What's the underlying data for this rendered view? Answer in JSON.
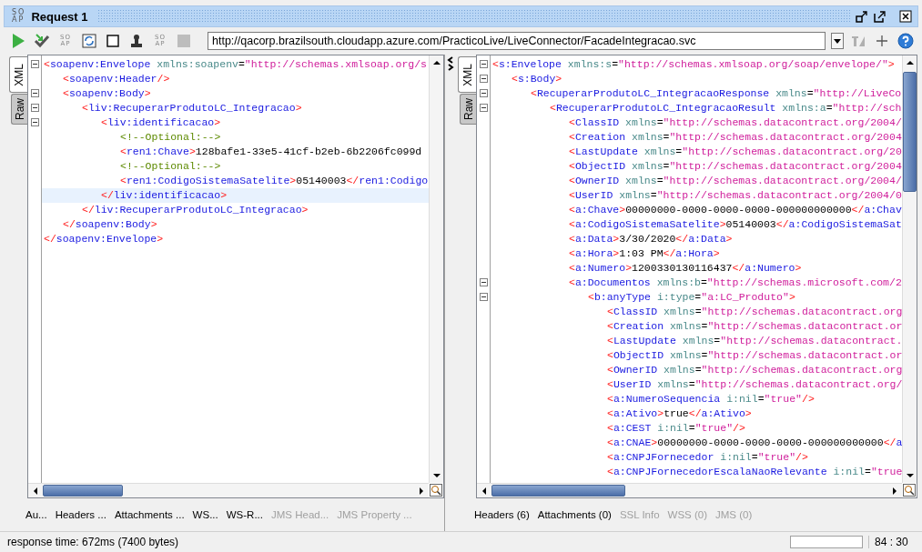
{
  "window": {
    "logo": [
      "SO",
      "AP"
    ],
    "title": "Request 1"
  },
  "toolbar": [
    {
      "kind": "run"
    },
    {
      "kind": "check"
    },
    {
      "kind": "soap",
      "glyph": [
        "SO",
        "AP"
      ]
    },
    {
      "kind": "refresh"
    },
    {
      "kind": "square"
    },
    {
      "kind": "stamp"
    },
    {
      "kind": "soap",
      "glyph": [
        "SO",
        "AP"
      ]
    },
    {
      "kind": "stop"
    }
  ],
  "url": {
    "value": "http://qacorp.brazilsouth.cloudapp.azure.com/PracticoLive/LiveConnector/FacadeIntegracao.svc"
  },
  "url_tools": [
    {
      "kind": "dropdown"
    },
    {
      "kind": "endpoint"
    },
    {
      "kind": "add"
    },
    {
      "kind": "help"
    }
  ],
  "left_pane": {
    "view_tabs": [
      {
        "label": "XML",
        "selected": true
      },
      {
        "label": "Raw",
        "selected": false
      }
    ],
    "lines": [
      {
        "tokens": [
          {
            "kind": "bracket",
            "text": "<"
          },
          {
            "kind": "tag",
            "text": "soapenv:Envelope"
          },
          {
            "kind": "attr",
            "text": " xmlns:soapenv"
          },
          {
            "kind": "equals",
            "text": "="
          },
          {
            "kind": "value",
            "text": "\"http://schemas.xmlsoap.org/s"
          }
        ],
        "expanded": true,
        "children": [
          {
            "tokens": [
              {
                "kind": "bracket",
                "text": "<"
              },
              {
                "kind": "tag",
                "text": "soapenv:Header"
              },
              {
                "kind": "bracket",
                "text": "/>"
              }
            ]
          },
          {
            "tokens": [
              {
                "kind": "bracket",
                "text": "<"
              },
              {
                "kind": "tag",
                "text": "soapenv:Body"
              },
              {
                "kind": "bracket",
                "text": ">"
              }
            ],
            "expanded": true,
            "children": [
              {
                "tokens": [
                  {
                    "kind": "bracket",
                    "text": "<"
                  },
                  {
                    "kind": "tag",
                    "text": "liv:RecuperarProdutoLC_Integracao"
                  },
                  {
                    "kind": "bracket",
                    "text": ">"
                  }
                ],
                "expanded": true,
                "children": [
                  {
                    "tokens": [
                      {
                        "kind": "bracket",
                        "text": "<"
                      },
                      {
                        "kind": "tag",
                        "text": "liv:identificacao"
                      },
                      {
                        "kind": "bracket",
                        "text": ">"
                      }
                    ],
                    "expanded": true,
                    "children": [
                      {
                        "tokens": [
                          {
                            "kind": "comment",
                            "text": "<!--Optional:-->"
                          }
                        ]
                      },
                      {
                        "tokens": [
                          {
                            "kind": "bracket",
                            "text": "<"
                          },
                          {
                            "kind": "tag",
                            "text": "ren1:Chave"
                          },
                          {
                            "kind": "bracket",
                            "text": ">"
                          },
                          {
                            "kind": "text",
                            "text": "128bafe1-33e5-41cf-b2eb-6b2206fc099d"
                          }
                        ]
                      },
                      {
                        "tokens": [
                          {
                            "kind": "comment",
                            "text": "<!--Optional:-->"
                          }
                        ]
                      },
                      {
                        "tokens": [
                          {
                            "kind": "bracket",
                            "text": "<"
                          },
                          {
                            "kind": "tag",
                            "text": "ren1:CodigoSistemaSatelite"
                          },
                          {
                            "kind": "bracket",
                            "text": ">"
                          },
                          {
                            "kind": "text",
                            "text": "05140003"
                          },
                          {
                            "kind": "bracket",
                            "text": "</"
                          },
                          {
                            "kind": "tag",
                            "text": "ren1:Codigo"
                          }
                        ]
                      }
                    ]
                  },
                  {
                    "tokens": [
                      {
                        "kind": "bracket",
                        "text": "</"
                      },
                      {
                        "kind": "tag",
                        "text": "liv:identificacao"
                      },
                      {
                        "kind": "bracket",
                        "text": ">"
                      }
                    ],
                    "current": true
                  }
                ]
              },
              {
                "tokens": [
                  {
                    "kind": "bracket",
                    "text": "</"
                  },
                  {
                    "kind": "tag",
                    "text": "liv:RecuperarProdutoLC_Integracao"
                  },
                  {
                    "kind": "bracket",
                    "text": ">"
                  }
                ]
              }
            ]
          },
          {
            "tokens": [
              {
                "kind": "bracket",
                "text": "</"
              },
              {
                "kind": "tag",
                "text": "soapenv:Body"
              },
              {
                "kind": "bracket",
                "text": ">"
              }
            ]
          }
        ]
      },
      {
        "tokens": [
          {
            "kind": "bracket",
            "text": "</"
          },
          {
            "kind": "tag",
            "text": "soapenv:Envelope"
          },
          {
            "kind": "bracket",
            "text": ">"
          }
        ]
      }
    ],
    "bottom_tabs": [
      {
        "label": "Au...",
        "disabled": false
      },
      {
        "label": "Headers ...",
        "disabled": false
      },
      {
        "label": "Attachments ...",
        "disabled": false
      },
      {
        "label": "WS...",
        "disabled": false
      },
      {
        "label": "WS-R...",
        "disabled": false
      },
      {
        "label": "JMS Head...",
        "disabled": true
      },
      {
        "label": "JMS Property ...",
        "disabled": true
      }
    ]
  },
  "right_pane": {
    "view_tabs": [
      {
        "label": "XML",
        "selected": true
      },
      {
        "label": "Raw",
        "selected": false
      }
    ],
    "lines": [
      {
        "tokens": [
          {
            "kind": "bracket",
            "text": "<"
          },
          {
            "kind": "tag",
            "text": "s:Envelope"
          },
          {
            "kind": "attr",
            "text": " xmlns:s"
          },
          {
            "kind": "equals",
            "text": "="
          },
          {
            "kind": "value",
            "text": "\"http://schemas.xmlsoap.org/soap/envelope/\""
          },
          {
            "kind": "bracket",
            "text": ">"
          }
        ],
        "expanded": true,
        "children": [
          {
            "tokens": [
              {
                "kind": "bracket",
                "text": "<"
              },
              {
                "kind": "tag",
                "text": "s:Body"
              },
              {
                "kind": "bracket",
                "text": ">"
              }
            ],
            "expanded": true,
            "children": [
              {
                "tokens": [
                  {
                    "kind": "bracket",
                    "text": "<"
                  },
                  {
                    "kind": "tag",
                    "text": "RecuperarProdutoLC_IntegracaoResponse"
                  },
                  {
                    "kind": "attr",
                    "text": " xmlns"
                  },
                  {
                    "kind": "equals",
                    "text": "="
                  },
                  {
                    "kind": "value",
                    "text": "\"http://LiveCo"
                  }
                ],
                "expanded": true,
                "children": [
                  {
                    "tokens": [
                      {
                        "kind": "bracket",
                        "text": "<"
                      },
                      {
                        "kind": "tag",
                        "text": "RecuperarProdutoLC_IntegracaoResult"
                      },
                      {
                        "kind": "attr",
                        "text": " xmlns:a"
                      },
                      {
                        "kind": "equals",
                        "text": "="
                      },
                      {
                        "kind": "value",
                        "text": "\"http://sch"
                      }
                    ],
                    "expanded": true,
                    "children": [
                      {
                        "tokens": [
                          {
                            "kind": "bracket",
                            "text": "<"
                          },
                          {
                            "kind": "tag",
                            "text": "ClassID"
                          },
                          {
                            "kind": "attr",
                            "text": " xmlns"
                          },
                          {
                            "kind": "equals",
                            "text": "="
                          },
                          {
                            "kind": "value",
                            "text": "\"http://schemas.datacontract.org/2004/"
                          }
                        ]
                      },
                      {
                        "tokens": [
                          {
                            "kind": "bracket",
                            "text": "<"
                          },
                          {
                            "kind": "tag",
                            "text": "Creation"
                          },
                          {
                            "kind": "attr",
                            "text": " xmlns"
                          },
                          {
                            "kind": "equals",
                            "text": "="
                          },
                          {
                            "kind": "value",
                            "text": "\"http://schemas.datacontract.org/2004"
                          }
                        ]
                      },
                      {
                        "tokens": [
                          {
                            "kind": "bracket",
                            "text": "<"
                          },
                          {
                            "kind": "tag",
                            "text": "LastUpdate"
                          },
                          {
                            "kind": "attr",
                            "text": " xmlns"
                          },
                          {
                            "kind": "equals",
                            "text": "="
                          },
                          {
                            "kind": "value",
                            "text": "\"http://schemas.datacontract.org/20"
                          }
                        ]
                      },
                      {
                        "tokens": [
                          {
                            "kind": "bracket",
                            "text": "<"
                          },
                          {
                            "kind": "tag",
                            "text": "ObjectID"
                          },
                          {
                            "kind": "attr",
                            "text": " xmlns"
                          },
                          {
                            "kind": "equals",
                            "text": "="
                          },
                          {
                            "kind": "value",
                            "text": "\"http://schemas.datacontract.org/2004"
                          }
                        ]
                      },
                      {
                        "tokens": [
                          {
                            "kind": "bracket",
                            "text": "<"
                          },
                          {
                            "kind": "tag",
                            "text": "OwnerID"
                          },
                          {
                            "kind": "attr",
                            "text": " xmlns"
                          },
                          {
                            "kind": "equals",
                            "text": "="
                          },
                          {
                            "kind": "value",
                            "text": "\"http://schemas.datacontract.org/2004/"
                          }
                        ]
                      },
                      {
                        "tokens": [
                          {
                            "kind": "bracket",
                            "text": "<"
                          },
                          {
                            "kind": "tag",
                            "text": "UserID"
                          },
                          {
                            "kind": "attr",
                            "text": " xmlns"
                          },
                          {
                            "kind": "equals",
                            "text": "="
                          },
                          {
                            "kind": "value",
                            "text": "\"http://schemas.datacontract.org/2004/0"
                          }
                        ]
                      },
                      {
                        "tokens": [
                          {
                            "kind": "bracket",
                            "text": "<"
                          },
                          {
                            "kind": "tag",
                            "text": "a:Chave"
                          },
                          {
                            "kind": "bracket",
                            "text": ">"
                          },
                          {
                            "kind": "text",
                            "text": "00000000-0000-0000-0000-000000000000"
                          },
                          {
                            "kind": "bracket",
                            "text": "</"
                          },
                          {
                            "kind": "tag",
                            "text": "a:Chav"
                          }
                        ]
                      },
                      {
                        "tokens": [
                          {
                            "kind": "bracket",
                            "text": "<"
                          },
                          {
                            "kind": "tag",
                            "text": "a:CodigoSistemaSatelite"
                          },
                          {
                            "kind": "bracket",
                            "text": ">"
                          },
                          {
                            "kind": "text",
                            "text": "05140003"
                          },
                          {
                            "kind": "bracket",
                            "text": "</"
                          },
                          {
                            "kind": "tag",
                            "text": "a:CodigoSistemaSat"
                          }
                        ]
                      },
                      {
                        "tokens": [
                          {
                            "kind": "bracket",
                            "text": "<"
                          },
                          {
                            "kind": "tag",
                            "text": "a:Data"
                          },
                          {
                            "kind": "bracket",
                            "text": ">"
                          },
                          {
                            "kind": "text",
                            "text": "3/30/2020"
                          },
                          {
                            "kind": "bracket",
                            "text": "</"
                          },
                          {
                            "kind": "tag",
                            "text": "a:Data"
                          },
                          {
                            "kind": "bracket",
                            "text": ">"
                          }
                        ]
                      },
                      {
                        "tokens": [
                          {
                            "kind": "bracket",
                            "text": "<"
                          },
                          {
                            "kind": "tag",
                            "text": "a:Hora"
                          },
                          {
                            "kind": "bracket",
                            "text": ">"
                          },
                          {
                            "kind": "text",
                            "text": "1:03 PM"
                          },
                          {
                            "kind": "bracket",
                            "text": "</"
                          },
                          {
                            "kind": "tag",
                            "text": "a:Hora"
                          },
                          {
                            "kind": "bracket",
                            "text": ">"
                          }
                        ]
                      },
                      {
                        "tokens": [
                          {
                            "kind": "bracket",
                            "text": "<"
                          },
                          {
                            "kind": "tag",
                            "text": "a:Numero"
                          },
                          {
                            "kind": "bracket",
                            "text": ">"
                          },
                          {
                            "kind": "text",
                            "text": "1200330130116437"
                          },
                          {
                            "kind": "bracket",
                            "text": "</"
                          },
                          {
                            "kind": "tag",
                            "text": "a:Numero"
                          },
                          {
                            "kind": "bracket",
                            "text": ">"
                          }
                        ]
                      },
                      {
                        "tokens": [
                          {
                            "kind": "bracket",
                            "text": "<"
                          },
                          {
                            "kind": "tag",
                            "text": "a:Documentos"
                          },
                          {
                            "kind": "attr",
                            "text": " xmlns:b"
                          },
                          {
                            "kind": "equals",
                            "text": "="
                          },
                          {
                            "kind": "value",
                            "text": "\"http://schemas.microsoft.com/2"
                          }
                        ],
                        "expanded": true,
                        "children": [
                          {
                            "tokens": [
                              {
                                "kind": "bracket",
                                "text": "<"
                              },
                              {
                                "kind": "tag",
                                "text": "b:anyType"
                              },
                              {
                                "kind": "attr",
                                "text": " i:type"
                              },
                              {
                                "kind": "equals",
                                "text": "="
                              },
                              {
                                "kind": "value",
                                "text": "\"a:LC_Produto\""
                              },
                              {
                                "kind": "bracket",
                                "text": ">"
                              }
                            ],
                            "expanded": true,
                            "children": [
                              {
                                "tokens": [
                                  {
                                    "kind": "bracket",
                                    "text": "<"
                                  },
                                  {
                                    "kind": "tag",
                                    "text": "ClassID"
                                  },
                                  {
                                    "kind": "attr",
                                    "text": " xmlns"
                                  },
                                  {
                                    "kind": "equals",
                                    "text": "="
                                  },
                                  {
                                    "kind": "value",
                                    "text": "\"http://schemas.datacontract.org"
                                  }
                                ]
                              },
                              {
                                "tokens": [
                                  {
                                    "kind": "bracket",
                                    "text": "<"
                                  },
                                  {
                                    "kind": "tag",
                                    "text": "Creation"
                                  },
                                  {
                                    "kind": "attr",
                                    "text": " xmlns"
                                  },
                                  {
                                    "kind": "equals",
                                    "text": "="
                                  },
                                  {
                                    "kind": "value",
                                    "text": "\"http://schemas.datacontract.or"
                                  }
                                ]
                              },
                              {
                                "tokens": [
                                  {
                                    "kind": "bracket",
                                    "text": "<"
                                  },
                                  {
                                    "kind": "tag",
                                    "text": "LastUpdate"
                                  },
                                  {
                                    "kind": "attr",
                                    "text": " xmlns"
                                  },
                                  {
                                    "kind": "equals",
                                    "text": "="
                                  },
                                  {
                                    "kind": "value",
                                    "text": "\"http://schemas.datacontract."
                                  }
                                ]
                              },
                              {
                                "tokens": [
                                  {
                                    "kind": "bracket",
                                    "text": "<"
                                  },
                                  {
                                    "kind": "tag",
                                    "text": "ObjectID"
                                  },
                                  {
                                    "kind": "attr",
                                    "text": " xmlns"
                                  },
                                  {
                                    "kind": "equals",
                                    "text": "="
                                  },
                                  {
                                    "kind": "value",
                                    "text": "\"http://schemas.datacontract.or"
                                  }
                                ]
                              },
                              {
                                "tokens": [
                                  {
                                    "kind": "bracket",
                                    "text": "<"
                                  },
                                  {
                                    "kind": "tag",
                                    "text": "OwnerID"
                                  },
                                  {
                                    "kind": "attr",
                                    "text": " xmlns"
                                  },
                                  {
                                    "kind": "equals",
                                    "text": "="
                                  },
                                  {
                                    "kind": "value",
                                    "text": "\"http://schemas.datacontract.org"
                                  }
                                ]
                              },
                              {
                                "tokens": [
                                  {
                                    "kind": "bracket",
                                    "text": "<"
                                  },
                                  {
                                    "kind": "tag",
                                    "text": "UserID"
                                  },
                                  {
                                    "kind": "attr",
                                    "text": " xmlns"
                                  },
                                  {
                                    "kind": "equals",
                                    "text": "="
                                  },
                                  {
                                    "kind": "value",
                                    "text": "\"http://schemas.datacontract.org/"
                                  }
                                ]
                              },
                              {
                                "tokens": [
                                  {
                                    "kind": "bracket",
                                    "text": "<"
                                  },
                                  {
                                    "kind": "tag",
                                    "text": "a:NumeroSequencia"
                                  },
                                  {
                                    "kind": "attr",
                                    "text": " i:nil"
                                  },
                                  {
                                    "kind": "equals",
                                    "text": "="
                                  },
                                  {
                                    "kind": "value",
                                    "text": "\"true\""
                                  },
                                  {
                                    "kind": "bracket",
                                    "text": "/>"
                                  }
                                ]
                              },
                              {
                                "tokens": [
                                  {
                                    "kind": "bracket",
                                    "text": "<"
                                  },
                                  {
                                    "kind": "tag",
                                    "text": "a:Ativo"
                                  },
                                  {
                                    "kind": "bracket",
                                    "text": ">"
                                  },
                                  {
                                    "kind": "text",
                                    "text": "true"
                                  },
                                  {
                                    "kind": "bracket",
                                    "text": "</"
                                  },
                                  {
                                    "kind": "tag",
                                    "text": "a:Ativo"
                                  },
                                  {
                                    "kind": "bracket",
                                    "text": ">"
                                  }
                                ]
                              },
                              {
                                "tokens": [
                                  {
                                    "kind": "bracket",
                                    "text": "<"
                                  },
                                  {
                                    "kind": "tag",
                                    "text": "a:CEST"
                                  },
                                  {
                                    "kind": "attr",
                                    "text": " i:nil"
                                  },
                                  {
                                    "kind": "equals",
                                    "text": "="
                                  },
                                  {
                                    "kind": "value",
                                    "text": "\"true\""
                                  },
                                  {
                                    "kind": "bracket",
                                    "text": "/>"
                                  }
                                ]
                              },
                              {
                                "tokens": [
                                  {
                                    "kind": "bracket",
                                    "text": "<"
                                  },
                                  {
                                    "kind": "tag",
                                    "text": "a:CNAE"
                                  },
                                  {
                                    "kind": "bracket",
                                    "text": ">"
                                  },
                                  {
                                    "kind": "text",
                                    "text": "00000000-0000-0000-0000-000000000000"
                                  },
                                  {
                                    "kind": "bracket",
                                    "text": "</"
                                  },
                                  {
                                    "kind": "tag",
                                    "text": "a"
                                  }
                                ]
                              },
                              {
                                "tokens": [
                                  {
                                    "kind": "bracket",
                                    "text": "<"
                                  },
                                  {
                                    "kind": "tag",
                                    "text": "a:CNPJFornecedor"
                                  },
                                  {
                                    "kind": "attr",
                                    "text": " i:nil"
                                  },
                                  {
                                    "kind": "equals",
                                    "text": "="
                                  },
                                  {
                                    "kind": "value",
                                    "text": "\"true\""
                                  },
                                  {
                                    "kind": "bracket",
                                    "text": "/>"
                                  }
                                ]
                              },
                              {
                                "tokens": [
                                  {
                                    "kind": "bracket",
                                    "text": "<"
                                  },
                                  {
                                    "kind": "tag",
                                    "text": "a:CNPJFornecedorEscalaNaoRelevante"
                                  },
                                  {
                                    "kind": "attr",
                                    "text": " i:nil"
                                  },
                                  {
                                    "kind": "equals",
                                    "text": "="
                                  },
                                  {
                                    "kind": "value",
                                    "text": "\"true"
                                  }
                                ]
                              }
                            ]
                          }
                        ]
                      }
                    ]
                  }
                ]
              }
            ]
          }
        ]
      }
    ],
    "bottom_tabs": [
      {
        "label": "Headers (6)",
        "disabled": false
      },
      {
        "label": "Attachments (0)",
        "disabled": false
      },
      {
        "label": "SSL Info",
        "disabled": true
      },
      {
        "label": "WSS (0)",
        "disabled": true
      },
      {
        "label": "JMS (0)",
        "disabled": true
      }
    ]
  },
  "status_bar": {
    "text": "response time: 672ms (7400 bytes)",
    "position": "84 : 30"
  }
}
